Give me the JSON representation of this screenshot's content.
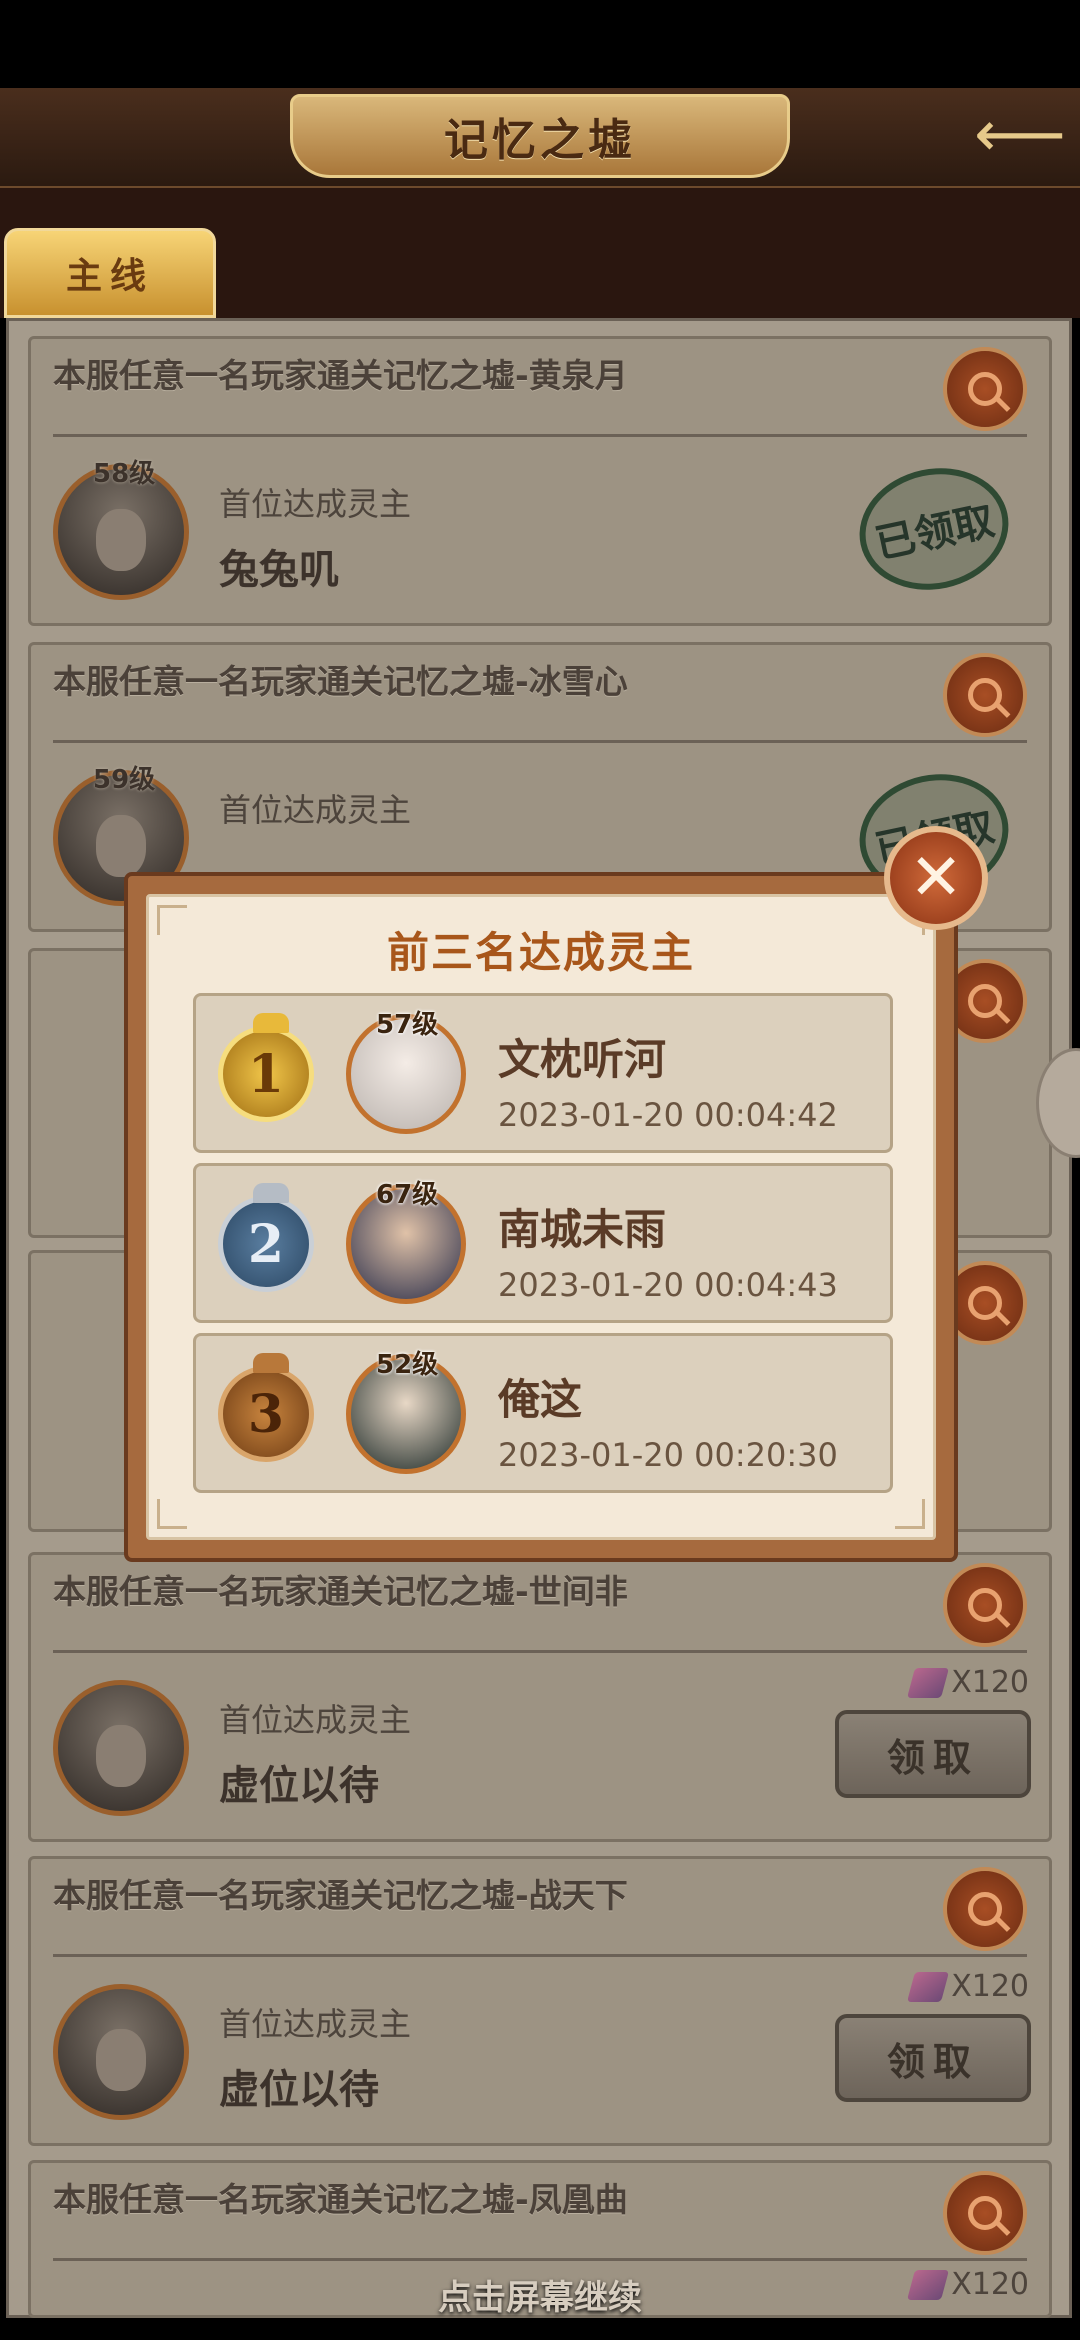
{
  "header": {
    "title": "记忆之墟",
    "back_icon": "arrow-left-icon"
  },
  "tabs": [
    {
      "label": "主线",
      "active": true
    }
  ],
  "cards": [
    {
      "title": "本服任意一名玩家通关记忆之墟-黄泉月",
      "level": "58级",
      "sub_label": "首位达成灵主",
      "player": "兔兔叽",
      "status": "已领取"
    },
    {
      "title": "本服任意一名玩家通关记忆之墟-冰雪心",
      "level": "59级",
      "sub_label": "首位达成灵主",
      "player": "",
      "status": "已领取"
    },
    {
      "title": "本服任意一名玩家通关记忆之墟-世间非",
      "level": "",
      "sub_label": "首位达成灵主",
      "player": "虚位以待",
      "reward": "X120",
      "button": "领取"
    },
    {
      "title": "本服任意一名玩家通关记忆之墟-战天下",
      "level": "",
      "sub_label": "首位达成灵主",
      "player": "虚位以待",
      "reward": "X120",
      "button": "领取"
    },
    {
      "title": "本服任意一名玩家通关记忆之墟-凤凰曲",
      "level": "",
      "sub_label": "",
      "player": "",
      "reward": "X120"
    }
  ],
  "modal": {
    "title": "前三名达成灵主",
    "rows": [
      {
        "rank": "1",
        "level": "57级",
        "name": "文枕听河",
        "time": "2023-01-20 00:04:42"
      },
      {
        "rank": "2",
        "level": "67级",
        "name": "南城未雨",
        "time": "2023-01-20 00:04:43"
      },
      {
        "rank": "3",
        "level": "52级",
        "name": "俺这",
        "time": "2023-01-20 00:20:30"
      }
    ]
  },
  "footer": {
    "continue_text": "点击屏幕继续"
  },
  "colors": {
    "accent": "#a8561a",
    "card_bg": "#9d9383",
    "modal_bg": "#f4e9d8"
  }
}
